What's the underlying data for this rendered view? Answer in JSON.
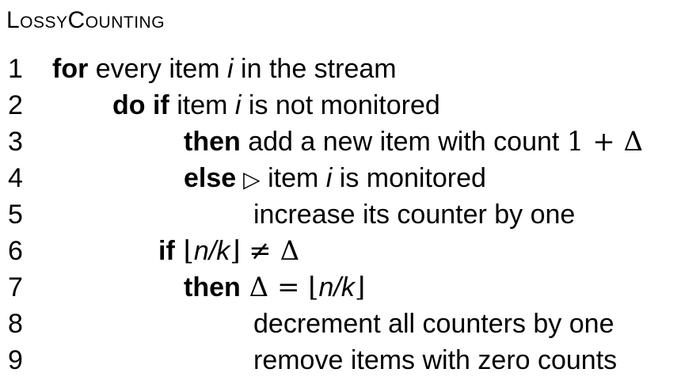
{
  "title": "LossyCounting",
  "lines": {
    "l1": {
      "num": "1",
      "kw": "for",
      "a": " every item ",
      "v": "i",
      "b": " in the stream"
    },
    "l2": {
      "num": "2",
      "kw": "do if",
      "a": " item ",
      "v": "i",
      "b": " is not monitored"
    },
    "l3": {
      "num": "3",
      "kw": "then",
      "a": " add a new item with count ",
      "m": "1 + Δ"
    },
    "l4": {
      "num": "4",
      "kw": "else",
      "s": " ▷",
      "a": " item ",
      "v": "i",
      "b": " is monitored"
    },
    "l5": {
      "num": "5",
      "t": "increase its counter by one"
    },
    "l6": {
      "num": "6",
      "kw": "if",
      "m1": " ⌊",
      "v": "n/k",
      "m2": "⌋ ≠ Δ"
    },
    "l7": {
      "num": "7",
      "kw": "then",
      "m1": " Δ = ⌊",
      "v": "n/k",
      "m2": "⌋"
    },
    "l8": {
      "num": "8",
      "t": "decrement all counters by one"
    },
    "l9": {
      "num": "9",
      "t": "remove items with zero counts"
    }
  }
}
